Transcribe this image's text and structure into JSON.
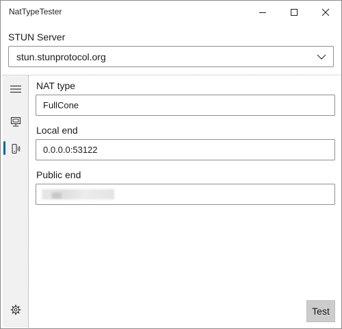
{
  "window": {
    "title": "NatTypeTester"
  },
  "stun": {
    "label": "STUN Server",
    "selected": "stun.stunprotocol.org"
  },
  "nav": {
    "items": [
      {
        "icon": "hamburger-menu-icon"
      },
      {
        "icon": "computer-monitor-icon"
      },
      {
        "icon": "device-signal-icon",
        "selected": true
      },
      {
        "icon": "gear-icon"
      }
    ],
    "accent_color": "#0063b1"
  },
  "main": {
    "nat_type": {
      "label": "NAT type",
      "value": "FullCone"
    },
    "local_end": {
      "label": "Local end",
      "value": "0.0.0.0:53122"
    },
    "public_end": {
      "label": "Public end",
      "value": ""
    },
    "test_button": "Test"
  }
}
